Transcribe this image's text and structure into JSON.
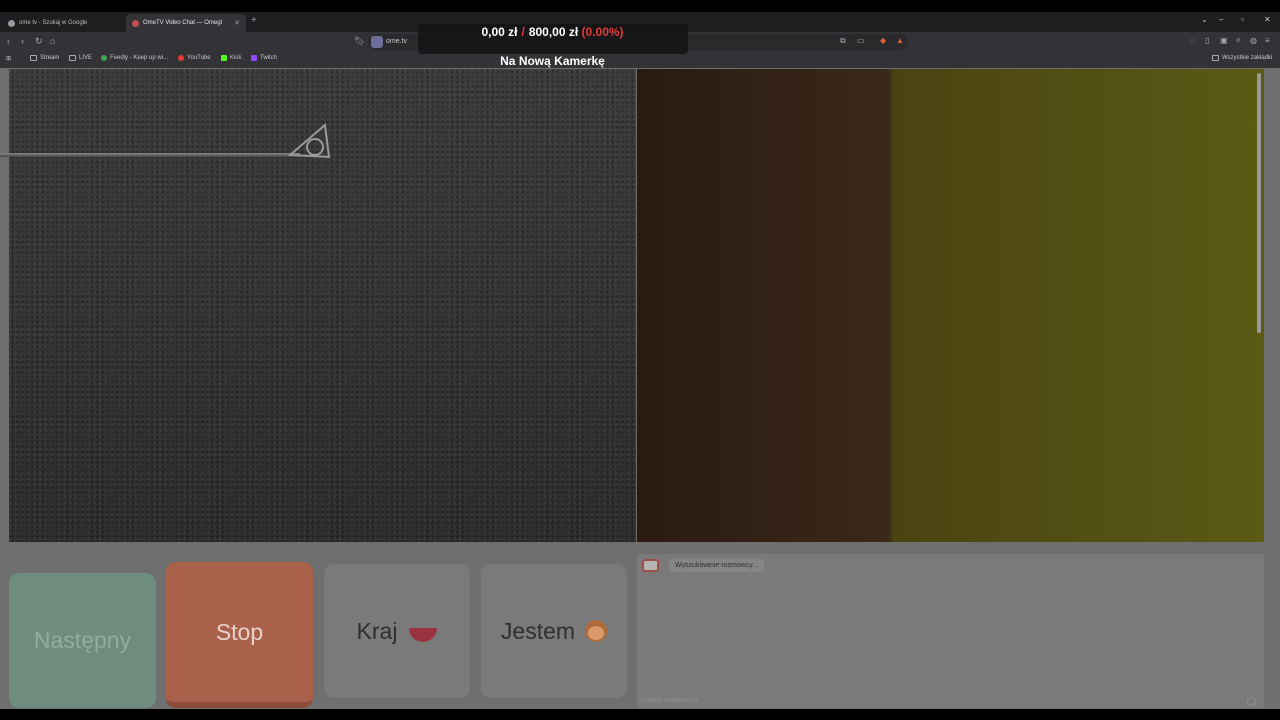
{
  "tabs": [
    {
      "title": "ome tv - Szukaj w Google"
    },
    {
      "title": "OmeTV Video Chat — Omegl"
    }
  ],
  "browser": {
    "url": "ome.tv",
    "bookmarks": [
      "Stream",
      "LIVE",
      "Feedly - Keep up wi...",
      "YouTube",
      "Kick",
      "Twitch"
    ],
    "all_bookmarks": "Wszystkie zakładki"
  },
  "overlay": {
    "current": "0,00 zł",
    "separator": "/",
    "goal": "800,00 zł",
    "percent": "(0.00%)",
    "title": "Na Nową Kamerkę"
  },
  "controls": {
    "next": "Następny",
    "stop": "Stop",
    "country": "Kraj",
    "iam": "Jestem"
  },
  "chat": {
    "status": "Wyszukiwanie rozmowcy...",
    "placeholder": "Napisz wiadomość"
  },
  "colors": {
    "next_button": "#6f8d7e",
    "stop_button": "#a9614c",
    "overlay_accent": "#e53935"
  }
}
